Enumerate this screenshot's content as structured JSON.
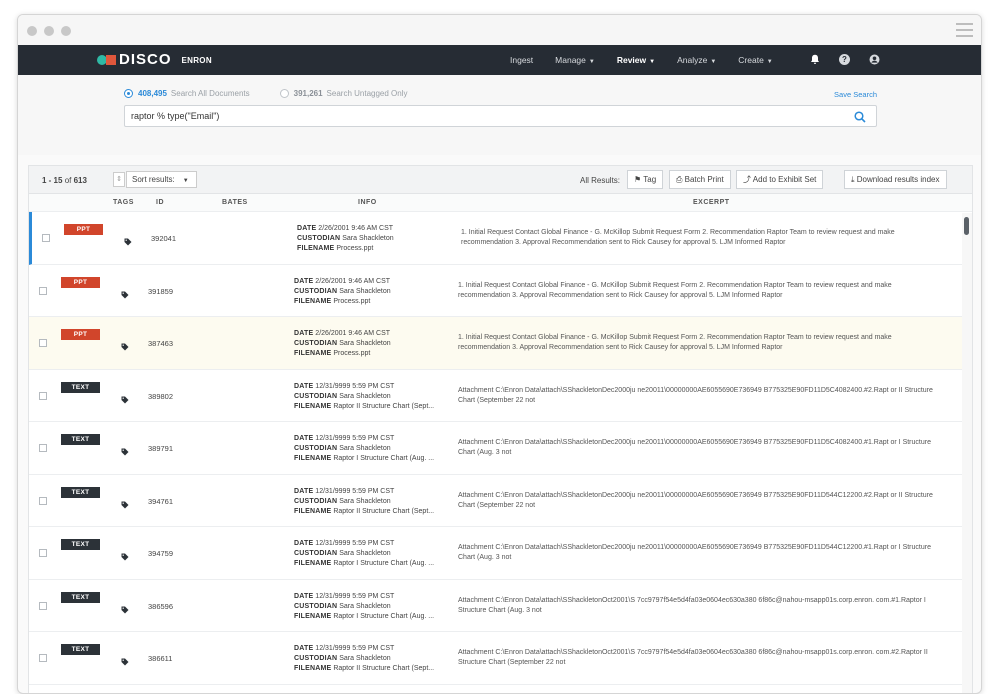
{
  "app": {
    "name": "DISCO",
    "case": "ENRON"
  },
  "nav": {
    "items": [
      {
        "label": "Ingest",
        "caret": false,
        "active": false
      },
      {
        "label": "Manage",
        "caret": true,
        "active": false
      },
      {
        "label": "Review",
        "caret": true,
        "active": true
      },
      {
        "label": "Analyze",
        "caret": true,
        "active": false
      },
      {
        "label": "Create",
        "caret": true,
        "active": false
      }
    ],
    "icons": [
      "bell-icon",
      "help-icon",
      "user-icon"
    ]
  },
  "search": {
    "option_all_count": "408,495",
    "option_all_label": "Search All Documents",
    "option_untagged_count": "391,261",
    "option_untagged_label": "Search Untagged Only",
    "save_label": "Save Search",
    "query": "raptor % type(\"Email\")"
  },
  "toolbar": {
    "range_prefix": "1 - 15",
    "range_of": "of",
    "range_total": "613",
    "sort_label": "Sort results:",
    "all_results_label": "All Results:",
    "tag_label": "Tag",
    "batch_print_label": "Batch Print",
    "exhibit_label": "Add to Exhibit Set",
    "download_label": "Download results index"
  },
  "columns": {
    "tags": "TAGS",
    "id": "ID",
    "bates": "BATES",
    "info": "INFO",
    "excerpt": "EXCERPT"
  },
  "info_labels": {
    "date": "DATE",
    "custodian": "CUSTODIAN",
    "filename": "FILENAME"
  },
  "rows": [
    {
      "type": "PPT",
      "id": "392041",
      "date": "2/26/2001 9:46 AM CST",
      "custodian": "Sara Shackleton",
      "filename": "Process.ppt",
      "excerpt": "1. Initial Request Contact Global Finance - G. McKillop Submit Request Form 2. Recommendation Raptor Team to review request and make recommendation 3. Approval Recommendation sent to Rick Causey for approval 5. LJM Informed Raptor"
    },
    {
      "type": "PPT",
      "id": "391859",
      "date": "2/26/2001 9:46 AM CST",
      "custodian": "Sara Shackleton",
      "filename": "Process.ppt",
      "excerpt": "1. Initial Request Contact Global Finance - G. McKillop Submit Request Form 2. Recommendation Raptor Team to review request and make recommendation 3. Approval Recommendation sent to Rick Causey for approval 5. LJM Informed Raptor"
    },
    {
      "type": "PPT",
      "id": "387463",
      "date": "2/26/2001 9:46 AM CST",
      "custodian": "Sara Shackleton",
      "filename": "Process.ppt",
      "excerpt": "1. Initial Request Contact Global Finance - G. McKillop Submit Request Form 2. Recommendation Raptor Team to review request and make recommendation 3. Approval Recommendation sent to Rick Causey for approval 5. LJM Informed Raptor"
    },
    {
      "type": "TEXT",
      "id": "389802",
      "date": "12/31/9999 5:59 PM CST",
      "custodian": "Sara Shackleton",
      "filename": "Raptor II Structure Chart (Sept...",
      "excerpt": "Attachment C:\\Enron Data\\attach\\SShackletonDec2000ju ne20011\\00000000AE6055690E736949 B775325E90FD11D5C4082400.#2.Rapt or II Structure Chart (September 22 not"
    },
    {
      "type": "TEXT",
      "id": "389791",
      "date": "12/31/9999 5:59 PM CST",
      "custodian": "Sara Shackleton",
      "filename": "Raptor I Structure Chart (Aug. ...",
      "excerpt": "Attachment C:\\Enron Data\\attach\\SShackletonDec2000ju ne20011\\00000000AE6055690E736949 B775325E90FD11D5C4082400.#1.Rapt or I Structure Chart (Aug. 3 not"
    },
    {
      "type": "TEXT",
      "id": "394761",
      "date": "12/31/9999 5:59 PM CST",
      "custodian": "Sara Shackleton",
      "filename": "Raptor II Structure Chart (Sept...",
      "excerpt": "Attachment C:\\Enron Data\\attach\\SShackletonDec2000ju ne20011\\00000000AE6055690E736949 B775325E90FD11D544C12200.#2.Rapt or II Structure Chart (September 22 not"
    },
    {
      "type": "TEXT",
      "id": "394759",
      "date": "12/31/9999 5:59 PM CST",
      "custodian": "Sara Shackleton",
      "filename": "Raptor I Structure Chart (Aug. ...",
      "excerpt": "Attachment C:\\Enron Data\\attach\\SShackletonDec2000ju ne20011\\00000000AE6055690E736949 B775325E90FD11D544C12200.#1.Rapt or I Structure Chart (Aug. 3 not"
    },
    {
      "type": "TEXT",
      "id": "386596",
      "date": "12/31/9999 5:59 PM CST",
      "custodian": "Sara Shackleton",
      "filename": "Raptor I Structure Chart (Aug. ...",
      "excerpt": "Attachment C:\\Enron Data\\attach\\SShackletonOct2001\\S 7cc9797f54e5d4fa03e0604ec630a380 6f86c@nahou-msapp01s.corp.enron. com.#1.Raptor I Structure Chart (Aug. 3 not"
    },
    {
      "type": "TEXT",
      "id": "386611",
      "date": "12/31/9999 5:59 PM CST",
      "custodian": "Sara Shackleton",
      "filename": "Raptor II Structure Chart (Sept...",
      "excerpt": "Attachment C:\\Enron Data\\attach\\SShackletonOct2001\\S 7cc9797f54e5d4fa03e0604ec630a380 6f86c@nahou-msapp01s.corp.enron. com.#2.Raptor II Structure Chart (September 22 not"
    }
  ]
}
